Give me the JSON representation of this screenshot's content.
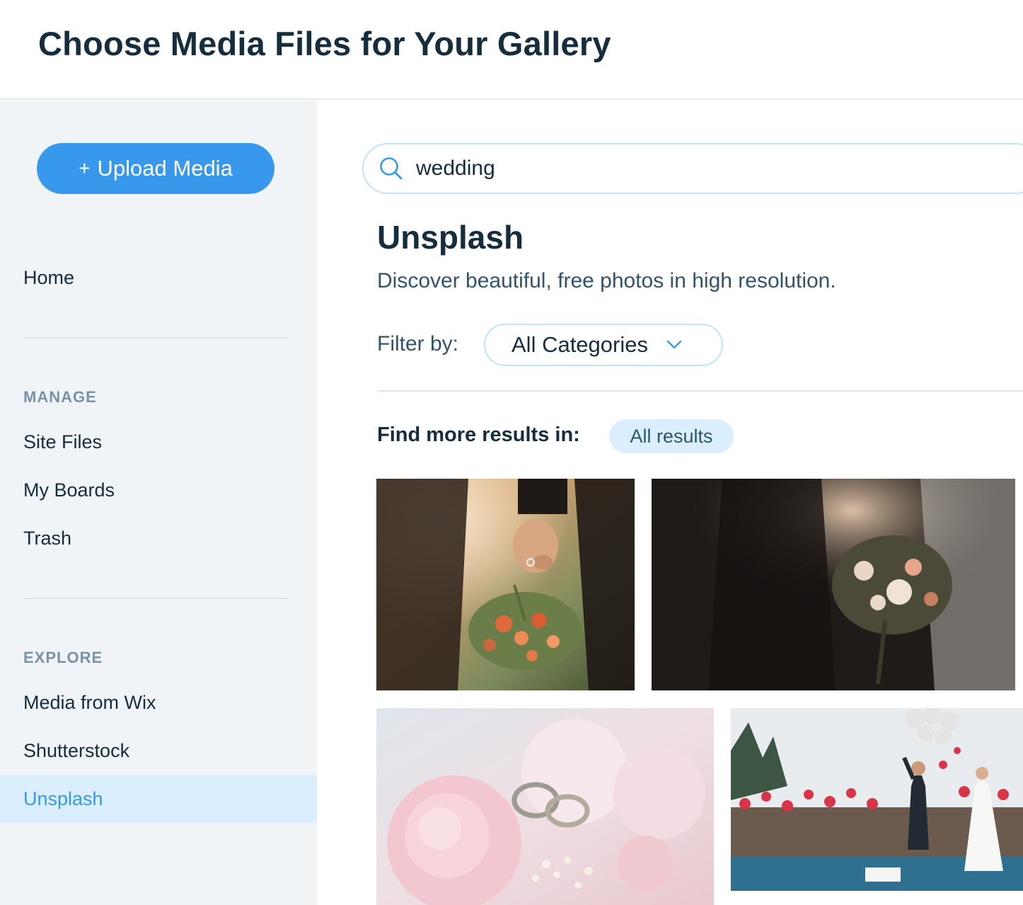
{
  "header": {
    "title": "Choose Media Files for Your Gallery"
  },
  "sidebar": {
    "upload_label": "Upload Media",
    "home_label": "Home",
    "manage_heading": "MANAGE",
    "manage_items": [
      "Site Files",
      "My Boards",
      "Trash"
    ],
    "explore_heading": "EXPLORE",
    "explore_items": [
      "Media from Wix",
      "Shutterstock",
      "Unsplash"
    ],
    "active_item": "Unsplash"
  },
  "main": {
    "search": {
      "value": "wedding",
      "icon": "search-icon"
    },
    "source_title": "Unsplash",
    "source_description": "Discover beautiful, free photos in high resolution.",
    "filter": {
      "label": "Filter by:",
      "selected": "All Categories",
      "icon": "chevron-down-icon"
    },
    "more_results": {
      "label": "Find more results in:",
      "chip": "All results"
    }
  },
  "colors": {
    "accent": "#3899ec",
    "sidebar_bg": "#f0f4f7",
    "active_bg": "#daeefd",
    "text_dark": "#162d3d",
    "text_muted": "#7a92a5"
  }
}
